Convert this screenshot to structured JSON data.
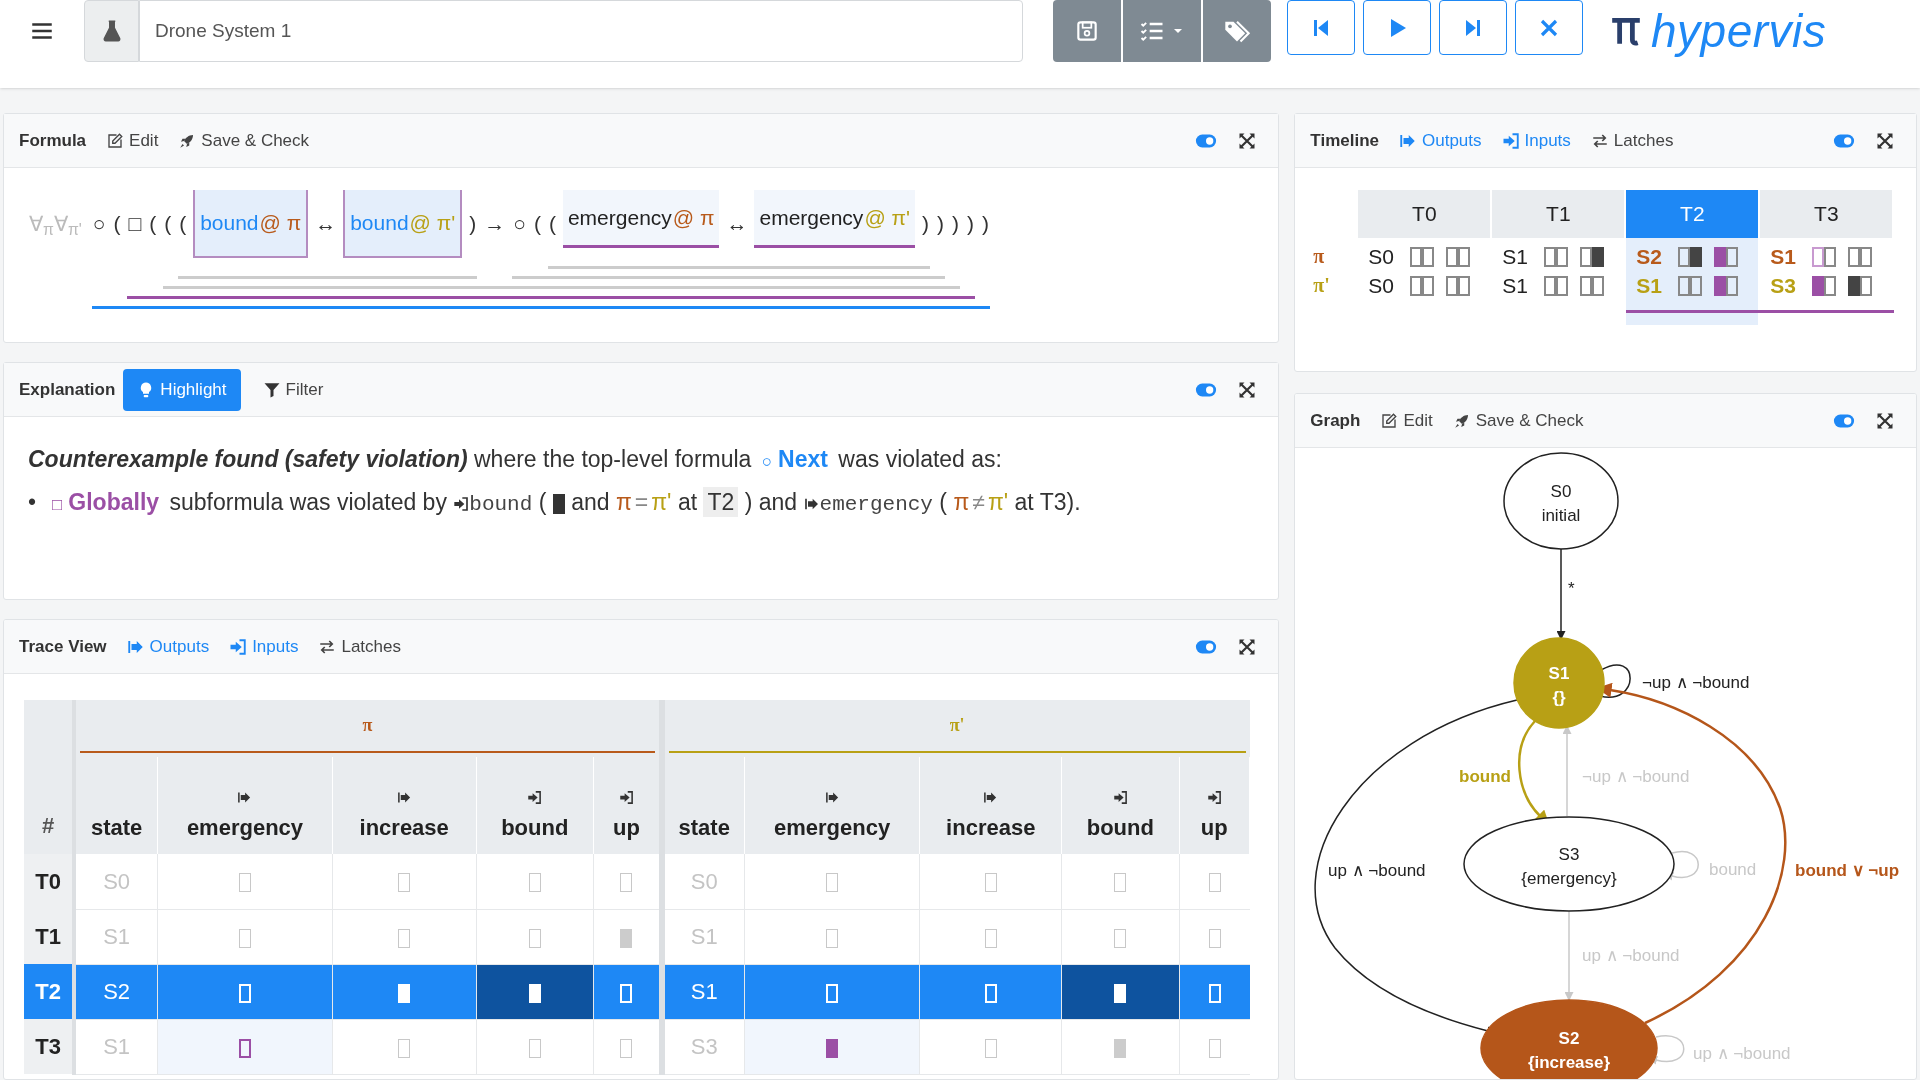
{
  "toolbar": {
    "document_name": "Drone System 1",
    "logo": "hypervis"
  },
  "formula": {
    "title": "Formula",
    "actions": [
      {
        "label": "Edit"
      },
      {
        "label": "Save & Check"
      }
    ],
    "expression": [
      {
        "kind": "quantifier",
        "text": "∀$_{π}$∀$_{π'}$"
      },
      {
        "kind": "group",
        "color": "#1e88f5",
        "children": [
          {
            "kind": "symbol",
            "text": "○"
          },
          {
            "kind": "symbol",
            "text": "("
          },
          {
            "kind": "group",
            "color": "#9b4fa5",
            "children": [
              {
                "kind": "symbol",
                "text": "□"
              },
              {
                "kind": "symbol",
                "text": "("
              },
              {
                "kind": "group",
                "color": "#cccccc",
                "children": [
                  {
                    "kind": "symbol",
                    "text": "("
                  },
                  {
                    "kind": "group",
                    "color": "#cccccc",
                    "children": [
                      {
                        "kind": "symbol",
                        "text": "("
                      },
                      {
                        "kind": "boxed-atom",
                        "name": "bound",
                        "trace": "@ π",
                        "color": "#b85a1b"
                      },
                      {
                        "kind": "symbol",
                        "text": "↔"
                      },
                      {
                        "kind": "boxed-atom",
                        "name": "bound",
                        "trace": "@ π'",
                        "color": "#b8a015"
                      },
                      {
                        "kind": "symbol",
                        "text": ")"
                      }
                    ]
                  },
                  {
                    "kind": "symbol",
                    "text": "→"
                  },
                  {
                    "kind": "group",
                    "color": "#cccccc",
                    "children": [
                      {
                        "kind": "symbol",
                        "text": "○"
                      },
                      {
                        "kind": "symbol",
                        "text": "("
                      },
                      {
                        "kind": "group",
                        "color": "#cccccc",
                        "children": [
                          {
                            "kind": "symbol",
                            "text": "("
                          },
                          {
                            "kind": "shaded-atom",
                            "name": "emergency",
                            "trace": "@ π",
                            "color": "#b85a1b"
                          },
                          {
                            "kind": "symbol",
                            "text": "↔"
                          },
                          {
                            "kind": "shaded-atom",
                            "name": "emergency",
                            "trace": "@ π'",
                            "color": "#b8a015"
                          },
                          {
                            "kind": "symbol",
                            "text": ")"
                          }
                        ]
                      },
                      {
                        "kind": "symbol",
                        "text": ")"
                      }
                    ]
                  },
                  {
                    "kind": "symbol",
                    "text": ")"
                  }
                ]
              },
              {
                "kind": "symbol",
                "text": ")"
              }
            ]
          },
          {
            "kind": "symbol",
            "text": ")"
          }
        ]
      }
    ]
  },
  "explanation": {
    "title": "Explanation",
    "actions": [
      {
        "label": "Highlight",
        "selected": true
      },
      {
        "label": "Filter",
        "selected": false
      }
    ],
    "lines": [
      {
        "segments": [
          {
            "kind": "emphasis",
            "text": "Counterexample found (safety violation)"
          },
          {
            "kind": "text",
            "text": "where the top-level formula"
          },
          {
            "kind": "operator",
            "symbol": "○",
            "label": "Next",
            "color": "#1e88f5"
          },
          {
            "kind": "text",
            "text": "was violated as:"
          }
        ]
      },
      {
        "bullet": "•",
        "segments": [
          {
            "kind": "operator",
            "symbol": "□",
            "label": "Globally",
            "color": "#9b4fa5"
          },
          {
            "kind": "text",
            "text": "subformula was violated by"
          },
          {
            "kind": "input-signal",
            "name": "bound"
          },
          {
            "kind": "text",
            "text": "("
          },
          {
            "kind": "square",
            "on": true
          },
          {
            "kind": "text",
            "text": "and"
          },
          {
            "kind": "relation",
            "left": "π",
            "op": "=",
            "right": "π'"
          },
          {
            "kind": "text",
            "text": "at"
          },
          {
            "kind": "time",
            "text": "T2"
          },
          {
            "kind": "text",
            "text": ") and"
          },
          {
            "kind": "output-signal",
            "name": "emergency"
          },
          {
            "kind": "text",
            "text": "("
          },
          {
            "kind": "relation",
            "left": "π",
            "op": "≠",
            "right": "π'"
          },
          {
            "kind": "text",
            "text": "at T3)."
          }
        ]
      }
    ]
  },
  "trace_view": {
    "title": "Trace View",
    "filters": [
      {
        "label": "Outputs",
        "active": true
      },
      {
        "label": "Inputs",
        "active": true
      },
      {
        "label": "Latches",
        "active": false
      }
    ],
    "index_header": "#",
    "groups": [
      {
        "name": "π",
        "color": "#b85a1b",
        "columns": [
          {
            "name": "state",
            "kind": "state"
          },
          {
            "name": "emergency",
            "kind": "output"
          },
          {
            "name": "increase",
            "kind": "output"
          },
          {
            "name": "bound",
            "kind": "input"
          },
          {
            "name": "up",
            "kind": "input"
          }
        ]
      },
      {
        "name": "π'",
        "color": "#b8a015",
        "columns": [
          {
            "name": "state",
            "kind": "state"
          },
          {
            "name": "emergency",
            "kind": "output"
          },
          {
            "name": "increase",
            "kind": "output"
          },
          {
            "name": "bound",
            "kind": "input"
          },
          {
            "name": "up",
            "kind": "input"
          }
        ]
      }
    ],
    "rows": [
      {
        "time": "T0",
        "selected": false,
        "traces": [
          {
            "state": "S0",
            "signals": [
              {
                "on": false,
                "marked": false,
                "highlight": false
              },
              {
                "on": false,
                "marked": false,
                "highlight": false
              },
              {
                "on": false,
                "marked": false,
                "highlight": false
              },
              {
                "on": false,
                "marked": false,
                "highlight": false
              }
            ]
          },
          {
            "state": "S0",
            "signals": [
              {
                "on": false,
                "marked": false,
                "highlight": false
              },
              {
                "on": false,
                "marked": false,
                "highlight": false
              },
              {
                "on": false,
                "marked": false,
                "highlight": false
              },
              {
                "on": false,
                "marked": false,
                "highlight": false
              }
            ]
          }
        ]
      },
      {
        "time": "T1",
        "selected": false,
        "traces": [
          {
            "state": "S1",
            "signals": [
              {
                "on": false,
                "marked": false,
                "highlight": false
              },
              {
                "on": false,
                "marked": false,
                "highlight": false
              },
              {
                "on": false,
                "marked": false,
                "highlight": false
              },
              {
                "on": true,
                "marked": false,
                "highlight": false
              }
            ]
          },
          {
            "state": "S1",
            "signals": [
              {
                "on": false,
                "marked": false,
                "highlight": false
              },
              {
                "on": false,
                "marked": false,
                "highlight": false
              },
              {
                "on": false,
                "marked": false,
                "highlight": false
              },
              {
                "on": false,
                "marked": false,
                "highlight": false
              }
            ]
          }
        ]
      },
      {
        "time": "T2",
        "selected": true,
        "traces": [
          {
            "state": "S2",
            "signals": [
              {
                "on": false,
                "marked": false,
                "highlight": false
              },
              {
                "on": true,
                "marked": false,
                "highlight": false
              },
              {
                "on": true,
                "marked": false,
                "highlight": true
              },
              {
                "on": false,
                "marked": false,
                "highlight": false
              }
            ]
          },
          {
            "state": "S1",
            "signals": [
              {
                "on": false,
                "marked": false,
                "highlight": false
              },
              {
                "on": false,
                "marked": false,
                "highlight": false
              },
              {
                "on": true,
                "marked": false,
                "highlight": true
              },
              {
                "on": false,
                "marked": false,
                "highlight": false
              }
            ]
          }
        ]
      },
      {
        "time": "T3",
        "selected": false,
        "traces": [
          {
            "state": "S1",
            "signals": [
              {
                "on": false,
                "marked": true,
                "highlight": true
              },
              {
                "on": false,
                "marked": false,
                "highlight": false
              },
              {
                "on": false,
                "marked": false,
                "highlight": false
              },
              {
                "on": false,
                "marked": false,
                "highlight": false
              }
            ]
          },
          {
            "state": "S3",
            "signals": [
              {
                "on": true,
                "marked": true,
                "highlight": true
              },
              {
                "on": false,
                "marked": false,
                "highlight": false
              },
              {
                "on": true,
                "marked": false,
                "highlight": false
              },
              {
                "on": false,
                "marked": false,
                "highlight": false
              }
            ]
          }
        ]
      }
    ]
  },
  "timeline": {
    "title": "Timeline",
    "filters": [
      {
        "label": "Outputs",
        "active": true
      },
      {
        "label": "Inputs",
        "active": true
      },
      {
        "label": "Latches",
        "active": false
      }
    ],
    "traces": [
      {
        "name": "π",
        "color": "#b85a1b"
      },
      {
        "name": "π'",
        "color": "#b8a015"
      }
    ],
    "steps": [
      {
        "time": "T0",
        "selected": false,
        "emphasized": false,
        "underlined": false,
        "cells": [
          {
            "state": "S0",
            "bits": [
              [
                {
                  "on": false,
                  "marked": false
                },
                {
                  "on": false,
                  "marked": false
                }
              ],
              [
                {
                  "on": false,
                  "marked": false
                },
                {
                  "on": false,
                  "marked": false
                }
              ]
            ]
          },
          {
            "state": "S0",
            "bits": [
              [
                {
                  "on": false,
                  "marked": false
                },
                {
                  "on": false,
                  "marked": false
                }
              ],
              [
                {
                  "on": false,
                  "marked": false
                },
                {
                  "on": false,
                  "marked": false
                }
              ]
            ]
          }
        ]
      },
      {
        "time": "T1",
        "selected": false,
        "emphasized": false,
        "underlined": false,
        "cells": [
          {
            "state": "S1",
            "bits": [
              [
                {
                  "on": false,
                  "marked": false
                },
                {
                  "on": false,
                  "marked": false
                }
              ],
              [
                {
                  "on": false,
                  "marked": false
                },
                {
                  "on": true,
                  "marked": false
                }
              ]
            ]
          },
          {
            "state": "S1",
            "bits": [
              [
                {
                  "on": false,
                  "marked": false
                },
                {
                  "on": false,
                  "marked": false
                }
              ],
              [
                {
                  "on": false,
                  "marked": false
                },
                {
                  "on": false,
                  "marked": false
                }
              ]
            ]
          }
        ]
      },
      {
        "time": "T2",
        "selected": true,
        "emphasized": true,
        "underlined": true,
        "cells": [
          {
            "state": "S2",
            "bits": [
              [
                {
                  "on": false,
                  "marked": false
                },
                {
                  "on": true,
                  "marked": false
                }
              ],
              [
                {
                  "on": true,
                  "marked": true
                },
                {
                  "on": false,
                  "marked": false
                }
              ]
            ]
          },
          {
            "state": "S1",
            "bits": [
              [
                {
                  "on": false,
                  "marked": false
                },
                {
                  "on": false,
                  "marked": false
                }
              ],
              [
                {
                  "on": true,
                  "marked": true
                },
                {
                  "on": false,
                  "marked": false
                }
              ]
            ]
          }
        ]
      },
      {
        "time": "T3",
        "selected": false,
        "emphasized": true,
        "underlined": true,
        "cells": [
          {
            "state": "S1",
            "bits": [
              [
                {
                  "on": false,
                  "marked": true
                },
                {
                  "on": false,
                  "marked": false
                }
              ],
              [
                {
                  "on": false,
                  "marked": false
                },
                {
                  "on": false,
                  "marked": false
                }
              ]
            ]
          },
          {
            "state": "S3",
            "bits": [
              [
                {
                  "on": true,
                  "marked": true
                },
                {
                  "on": false,
                  "marked": false
                }
              ],
              [
                {
                  "on": true,
                  "marked": false
                },
                {
                  "on": false,
                  "marked": false
                }
              ]
            ]
          }
        ]
      }
    ]
  },
  "graph": {
    "title": "Graph",
    "actions": [
      {
        "label": "Edit"
      },
      {
        "label": "Save & Check"
      }
    ],
    "nodes": [
      {
        "name": "S0",
        "label": "initial"
      },
      {
        "name": "S1",
        "label": "{}",
        "color": "#b8a015"
      },
      {
        "name": "S3",
        "label": "{emergency}"
      },
      {
        "name": "S2",
        "label": "{increase}",
        "color": "#b5561a"
      }
    ],
    "edges": [
      {
        "label": "*",
        "kind": "plain"
      },
      {
        "label": "¬up ∧ ¬bound",
        "kind": "plain"
      },
      {
        "label": "bound",
        "kind": "trace",
        "color": "#b8a015"
      },
      {
        "label": "¬up ∧ ¬bound",
        "kind": "dim"
      },
      {
        "label": "up ∧ ¬bound",
        "kind": "plain"
      },
      {
        "label": "bound",
        "kind": "dim"
      },
      {
        "label": "bound ∨ ¬up",
        "kind": "trace",
        "color": "#b5561a"
      },
      {
        "label": "up ∧ ¬bound",
        "kind": "dim"
      },
      {
        "label": "up ∧ ¬bound",
        "kind": "dim"
      }
    ]
  }
}
